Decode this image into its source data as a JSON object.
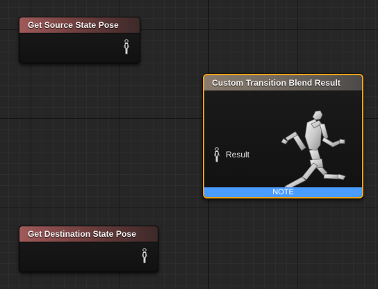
{
  "nodes": {
    "source": {
      "title": "Get Source State Pose",
      "pin_icon": "pose-pin-icon"
    },
    "result": {
      "title": "Custom Transition Blend Result",
      "input_label": "Result",
      "pin_icon": "pose-pin-icon",
      "preview_icon": "running-mannequin-icon",
      "note": "NOTE"
    },
    "destination": {
      "title": "Get Destination State Pose",
      "pin_icon": "pose-pin-icon"
    }
  },
  "colors": {
    "selection_outline": "#f3a21b",
    "note_bar": "#4b9cff",
    "get_pose_header": "#a05a5a",
    "result_header": "#8a7c6d"
  }
}
